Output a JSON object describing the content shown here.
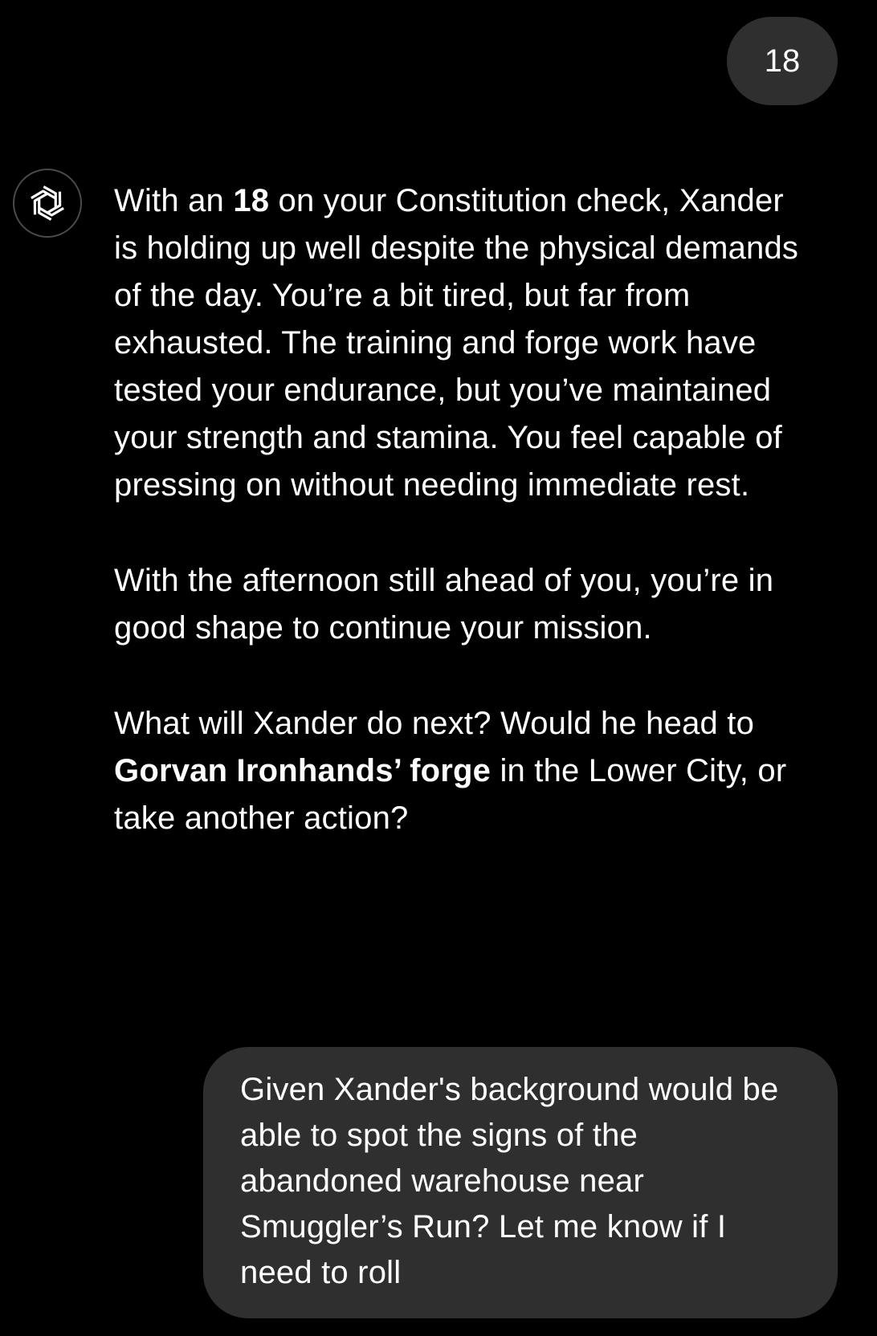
{
  "user_message_1": {
    "text": "18"
  },
  "assistant_avatar": {
    "icon": "openai-logo-icon"
  },
  "assistant_message": {
    "paragraph_1": {
      "before": "With an ",
      "bold": "18",
      "after": " on your Constitution check, Xander is holding up well despite the physical demands of the day. You’re a bit tired, but far from exhausted. The training and forge work have tested your endurance, but you’ve maintained your strength and stamina. You feel capable of pressing on without needing immediate rest."
    },
    "paragraph_2": {
      "text": "With the afternoon still ahead of you, you’re in good shape to continue your mission."
    },
    "paragraph_3": {
      "before": "What will Xander do next? Would he head to ",
      "bold": "Gorvan Ironhands’ forge",
      "after": " in the Lower City, or take another action?"
    }
  },
  "user_message_2": {
    "text": "Given Xander's background would be able to spot the signs of the abandoned warehouse near Smuggler’s Run? Let me know if I need to roll"
  },
  "colors": {
    "background": "#000000",
    "bubble": "#2f2f2f",
    "text": "#ffffff",
    "avatar_border": "#4a4a4a"
  }
}
